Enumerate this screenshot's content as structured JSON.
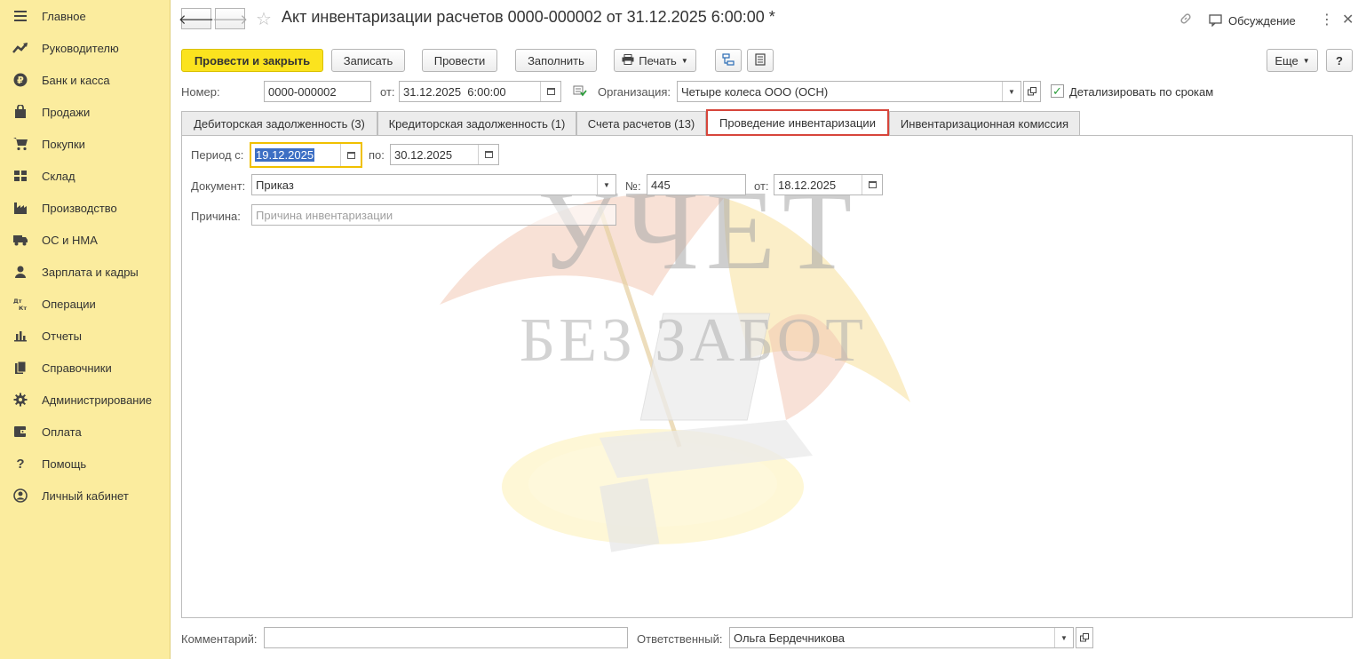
{
  "sidebar": {
    "items": [
      {
        "label": "Главное",
        "icon": "menu-icon"
      },
      {
        "label": "Руководителю",
        "icon": "trend-icon"
      },
      {
        "label": "Банк и касса",
        "icon": "ruble-icon"
      },
      {
        "label": "Продажи",
        "icon": "bag-icon"
      },
      {
        "label": "Покупки",
        "icon": "cart-icon"
      },
      {
        "label": "Склад",
        "icon": "warehouse-icon"
      },
      {
        "label": "Производство",
        "icon": "factory-icon"
      },
      {
        "label": "ОС и НМА",
        "icon": "truck-icon"
      },
      {
        "label": "Зарплата и кадры",
        "icon": "person-icon"
      },
      {
        "label": "Операции",
        "icon": "debit-credit-icon"
      },
      {
        "label": "Отчеты",
        "icon": "bar-chart-icon"
      },
      {
        "label": "Справочники",
        "icon": "books-icon"
      },
      {
        "label": "Администрирование",
        "icon": "gear-icon"
      },
      {
        "label": "Оплата",
        "icon": "wallet-icon"
      },
      {
        "label": "Помощь",
        "icon": "question-icon"
      },
      {
        "label": "Личный кабинет",
        "icon": "user-circle-icon"
      }
    ]
  },
  "header": {
    "title": "Акт инвентаризации расчетов 0000-000002 от 31.12.2025 6:00:00 *",
    "discussion_label": "Обсуждение"
  },
  "toolbar": {
    "post_close_label": "Провести и закрыть",
    "save_label": "Записать",
    "post_label": "Провести",
    "fill_label": "Заполнить",
    "print_label": "Печать",
    "more_label": "Еще",
    "help_label": "?"
  },
  "form": {
    "number_label": "Номер:",
    "number_value": "0000-000002",
    "date_label": "от:",
    "date_value": "31.12.2025  6:00:00",
    "org_label": "Организация:",
    "org_value": "Четыре колеса ООО (ОСН)",
    "detail_label": "Детализировать по срокам",
    "detail_checked": true
  },
  "tabs": [
    {
      "label": "Дебиторская задолженность (3)"
    },
    {
      "label": "Кредиторская задолженность (1)"
    },
    {
      "label": "Счета расчетов (13)"
    },
    {
      "label": "Проведение инвентаризации"
    },
    {
      "label": "Инвентаризационная комиссия"
    }
  ],
  "panel": {
    "period_label": "Период с:",
    "period_from": "19.12.2025",
    "period_to_label": "по:",
    "period_to": "30.12.2025",
    "doc_label": "Документ:",
    "doc_value": "Приказ",
    "doc_num_label": "№:",
    "doc_num_value": "445",
    "doc_date_label": "от:",
    "doc_date_value": "18.12.2025",
    "reason_label": "Причина:",
    "reason_placeholder": "Причина инвентаризации"
  },
  "watermark": {
    "line1": "УЧЕТ",
    "line2": "БЕЗ ЗАБОТ"
  },
  "footer": {
    "comment_label": "Комментарий:",
    "comment_value": "",
    "responsible_label": "Ответственный:",
    "responsible_value": "Ольга Бердечникова"
  },
  "colors": {
    "sidebar_bg": "#fbec9e",
    "primary_button": "#fbe31e",
    "active_tab_border": "#d7453b",
    "focus_border": "#f0c000",
    "selection": "#3d6fc4"
  }
}
